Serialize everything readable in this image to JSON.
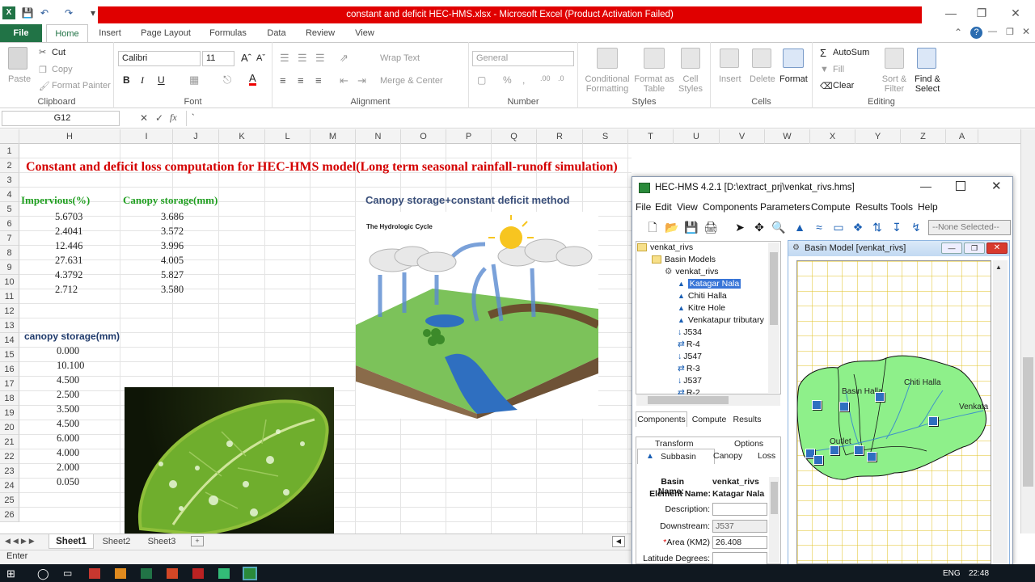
{
  "window": {
    "title": "constant and deficit HEC-HMS.xlsx  -  Microsoft Excel (Product Activation Failed)"
  },
  "ribbon": {
    "tabs": [
      "File",
      "Home",
      "Insert",
      "Page Layout",
      "Formulas",
      "Data",
      "Review",
      "View"
    ],
    "clipboard": {
      "label": "Clipboard",
      "paste": "Paste",
      "cut": "Cut",
      "copy": "Copy",
      "format_painter": "Format Painter"
    },
    "font": {
      "label": "Font",
      "name": "Calibri",
      "size": "11"
    },
    "alignment": {
      "label": "Alignment",
      "wrap_text": "Wrap Text",
      "merge": "Merge & Center"
    },
    "number": {
      "label": "Number",
      "format": "General"
    },
    "styles": {
      "label": "Styles",
      "conditional": "Conditional Formatting",
      "format_table": "Format as Table",
      "cell_styles": "Cell Styles"
    },
    "cells": {
      "label": "Cells",
      "insert": "Insert",
      "delete": "Delete",
      "format": "Format"
    },
    "editing": {
      "label": "Editing",
      "autosum": "AutoSum",
      "fill": "Fill",
      "clear": "Clear",
      "sort": "Sort & Filter",
      "find": "Find & Select"
    }
  },
  "formula_bar": {
    "name_box": "G12",
    "content": "`"
  },
  "columns": [
    "H",
    "I",
    "J",
    "K",
    "L",
    "M",
    "N",
    "O",
    "P",
    "Q",
    "R",
    "S",
    "T",
    "U",
    "V",
    "W",
    "X",
    "Y",
    "Z",
    "A"
  ],
  "rows": [
    "1",
    "2",
    "3",
    "4",
    "5",
    "6",
    "7",
    "8",
    "9",
    "10",
    "11",
    "12",
    "13",
    "14",
    "15",
    "16",
    "17",
    "18",
    "19",
    "20",
    "21",
    "22",
    "23",
    "24",
    "25",
    "26"
  ],
  "sheet": {
    "heading": "Constant and deficit loss computation  for HEC-HMS model(Long term seasonal rainfall-runoff simulation)",
    "col_h_header": "Impervious(%)",
    "col_i_header": "Canopy storage(mm)",
    "impervious": [
      "5.6703",
      "2.4041",
      "12.446",
      "27.631",
      "4.3792",
      "2.712"
    ],
    "canopy": [
      "3.686",
      "3.572",
      "3.996",
      "4.005",
      "5.827",
      "3.580"
    ],
    "canopy2_header": "canopy storage(mm)",
    "canopy2": [
      "0.000",
      "10.100",
      "4.500",
      "2.500",
      "3.500",
      "4.500",
      "6.000",
      "4.000",
      "2.000",
      "0.050"
    ],
    "diagram_caption": "Canopy storage+constant deficit method",
    "diagram_title": "The Hydrologic Cycle"
  },
  "sheet_tabs": [
    "Sheet1",
    "Sheet2",
    "Sheet3"
  ],
  "status": "Enter",
  "hms": {
    "title": "HEC-HMS 4.2.1 [D:\\extract_prj\\venkat_rivs.hms]",
    "menu": [
      "File",
      "Edit",
      "View",
      "Components",
      "Parameters",
      "Compute",
      "Results",
      "Tools",
      "Help"
    ],
    "selector": "--None Selected--",
    "tree": [
      "venkat_rivs",
      "Basin Models",
      "venkat_rivs",
      "Katagar Nala",
      "Chiti Halla",
      "Kitre Hole",
      "Venkatapur tributary",
      "J534",
      "R-4",
      "J547",
      "R-3",
      "J537",
      "R-2"
    ],
    "bottom_tabs": [
      "Components",
      "Compute",
      "Results"
    ],
    "prop_tabs_top": [
      "Transform",
      "Options"
    ],
    "prop_tabs": [
      "Subbasin",
      "Canopy",
      "Loss"
    ],
    "basin_name_label": "Basin Name:",
    "basin_name": "venkat_rivs",
    "element_name_label": "Element Name:",
    "element_name": "Katagar Nala",
    "description_label": "Description:",
    "downstream_label": "Downstream:",
    "downstream": "J537",
    "area_label": "Area (KM2)",
    "area": "26.408",
    "latitude_label": "Latitude Degrees:",
    "basin_window_title": "Basin Model [venkat_rivs]",
    "map_labels": [
      "Basin Halla",
      "Chiti Halla",
      "Venkata",
      "Outlet"
    ]
  },
  "taskbar": {
    "lang": "ENG",
    "time": "22:48"
  },
  "colors": {
    "excel_green": "#217346",
    "title_red": "#e00000",
    "sheet_heading": "#d40000",
    "green_header": "#1f9e1f",
    "navy_header": "#1f3a6b",
    "map_fill": "#8ef08a"
  }
}
